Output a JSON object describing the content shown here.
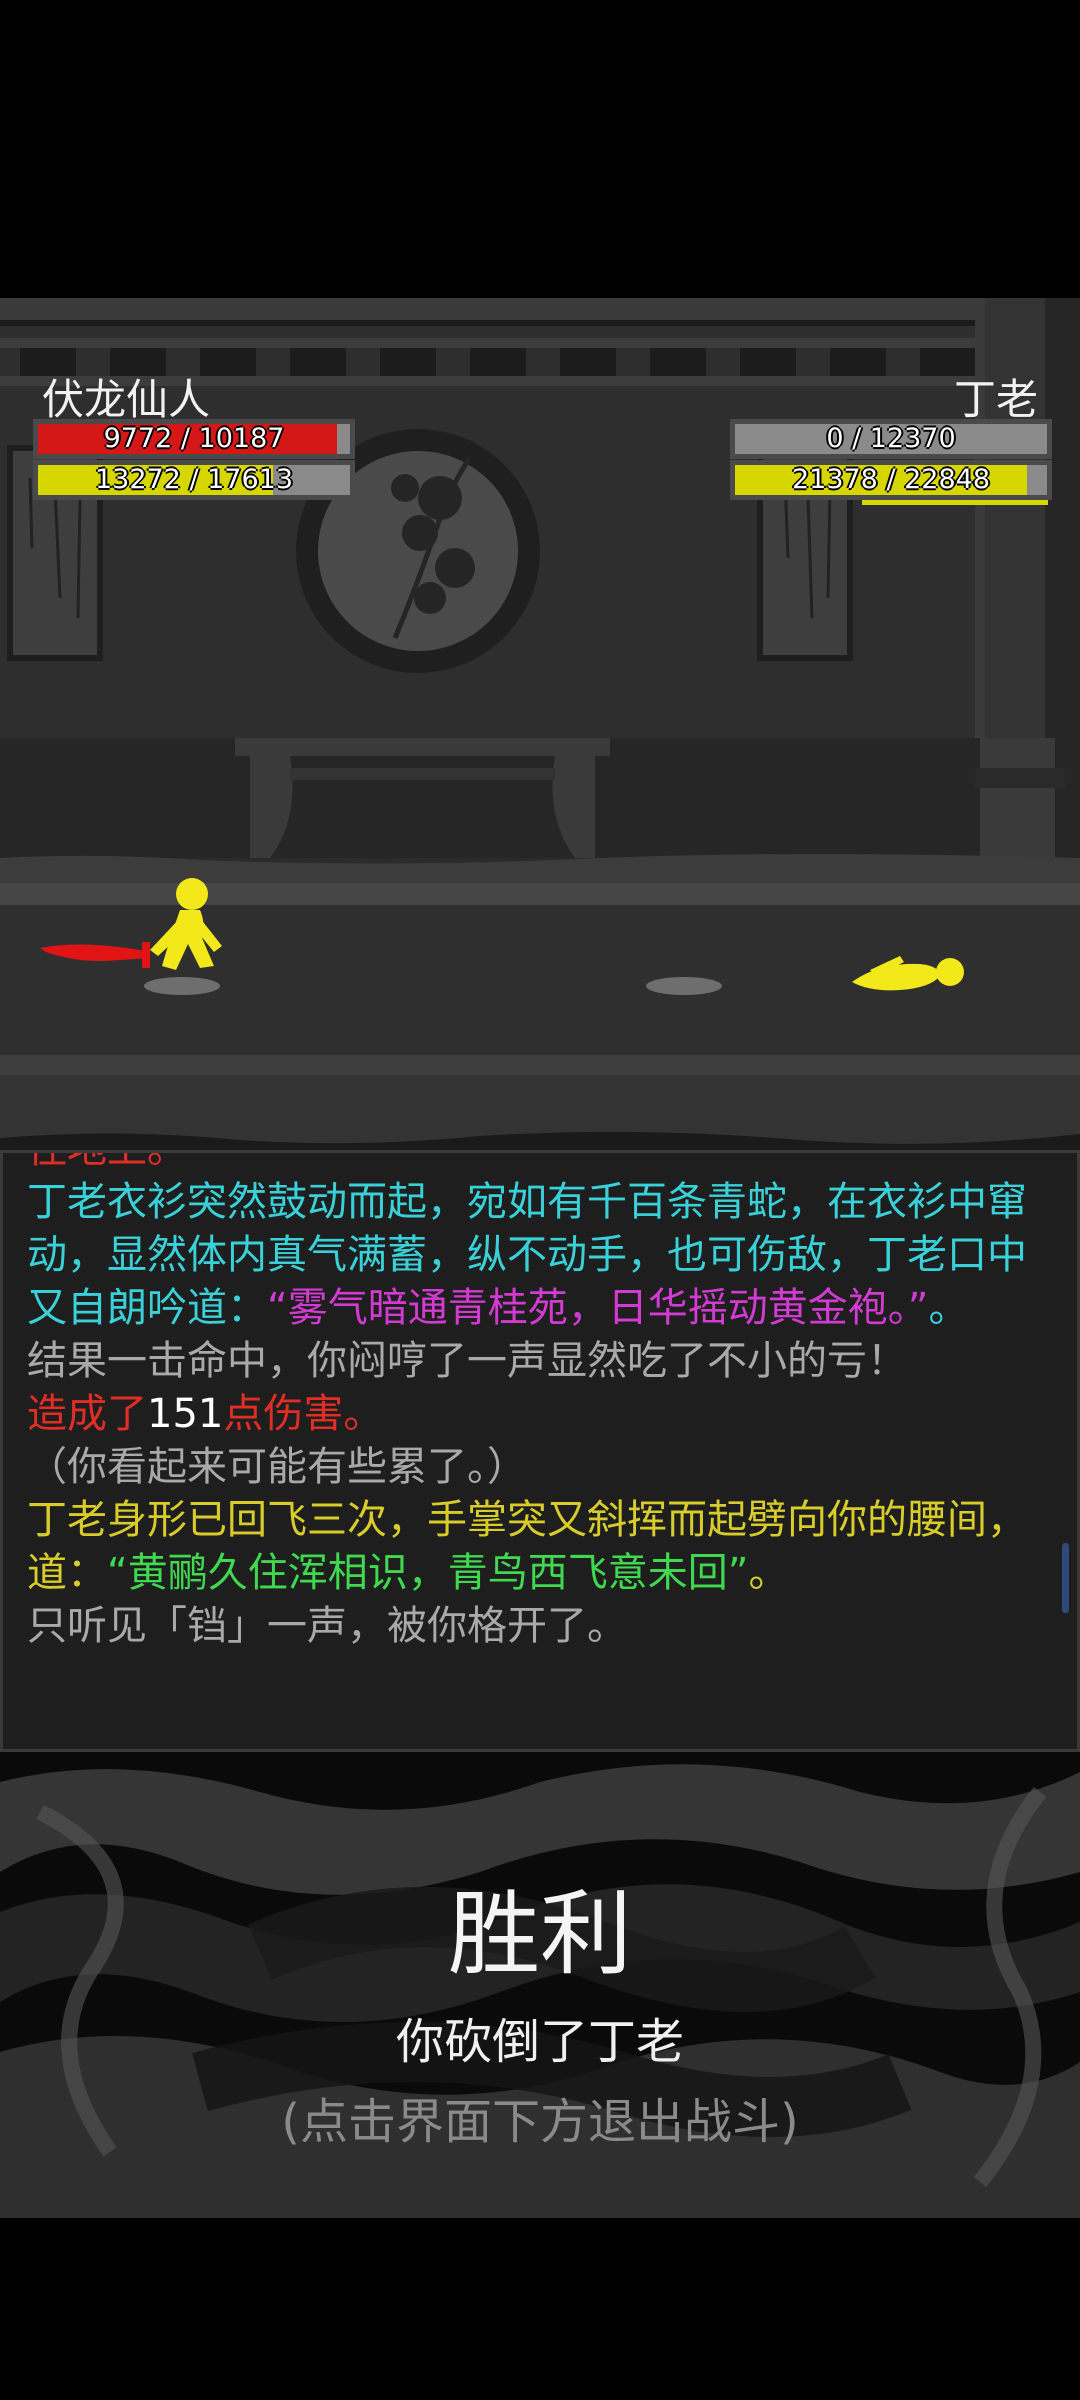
{
  "player": {
    "name": "伏龙仙人",
    "hp_text": "9772 / 10187",
    "hp_fraction": 0.959,
    "mp_text": "13272 / 17613",
    "mp_fraction": 0.754
  },
  "enemy": {
    "name": "丁老",
    "hp_text": "0 / 12370",
    "hp_fraction": 0.0,
    "mp_text": "21378 / 22848",
    "mp_fraction": 0.936
  },
  "colors": {
    "hp": "#d41818",
    "mp": "#d6d600",
    "hp_empty": "#8a8a8a",
    "weapon": "#e01414",
    "figure": "#f2e81a"
  },
  "log": {
    "cut_top": "住地上。",
    "entries": [
      [
        {
          "text": "丁老衣衫突然鼓动而起，宛如有千百条青蛇，在衣衫中窜动，显然体内真气满蓄，纵不动手，也可伤敌，丁老口中又自朗吟道：",
          "color": "cyan"
        },
        {
          "text": "“雾气暗通青桂苑，日华摇动黄金袍。”",
          "color": "magenta"
        },
        {
          "text": "。",
          "color": "cyan"
        }
      ],
      [
        {
          "text": "结果一击命中，你闷哼了一声显然吃了不小的亏！",
          "color": "gray"
        }
      ],
      [
        {
          "text": "造成了",
          "color": "red"
        },
        {
          "text": "151",
          "color": "white"
        },
        {
          "text": "点伤害。",
          "color": "red"
        }
      ],
      [
        {
          "text": "（你看起来可能有些累了。）",
          "color": "gray"
        }
      ],
      [
        {
          "text": "丁老身形已回飞三次，手掌突又斜挥而起劈向你的腰间，道：",
          "color": "yellow"
        },
        {
          "text": "“黄鹂久住浑相识，青鸟西飞意未回”",
          "color": "green"
        },
        {
          "text": "。",
          "color": "yellow"
        }
      ],
      [
        {
          "text": "只听见「铛」一声，被你格开了。",
          "color": "gray"
        }
      ]
    ]
  },
  "victory": {
    "title": "胜利",
    "message": "你砍倒了丁老",
    "hint": "(点击界面下方退出战斗)"
  }
}
